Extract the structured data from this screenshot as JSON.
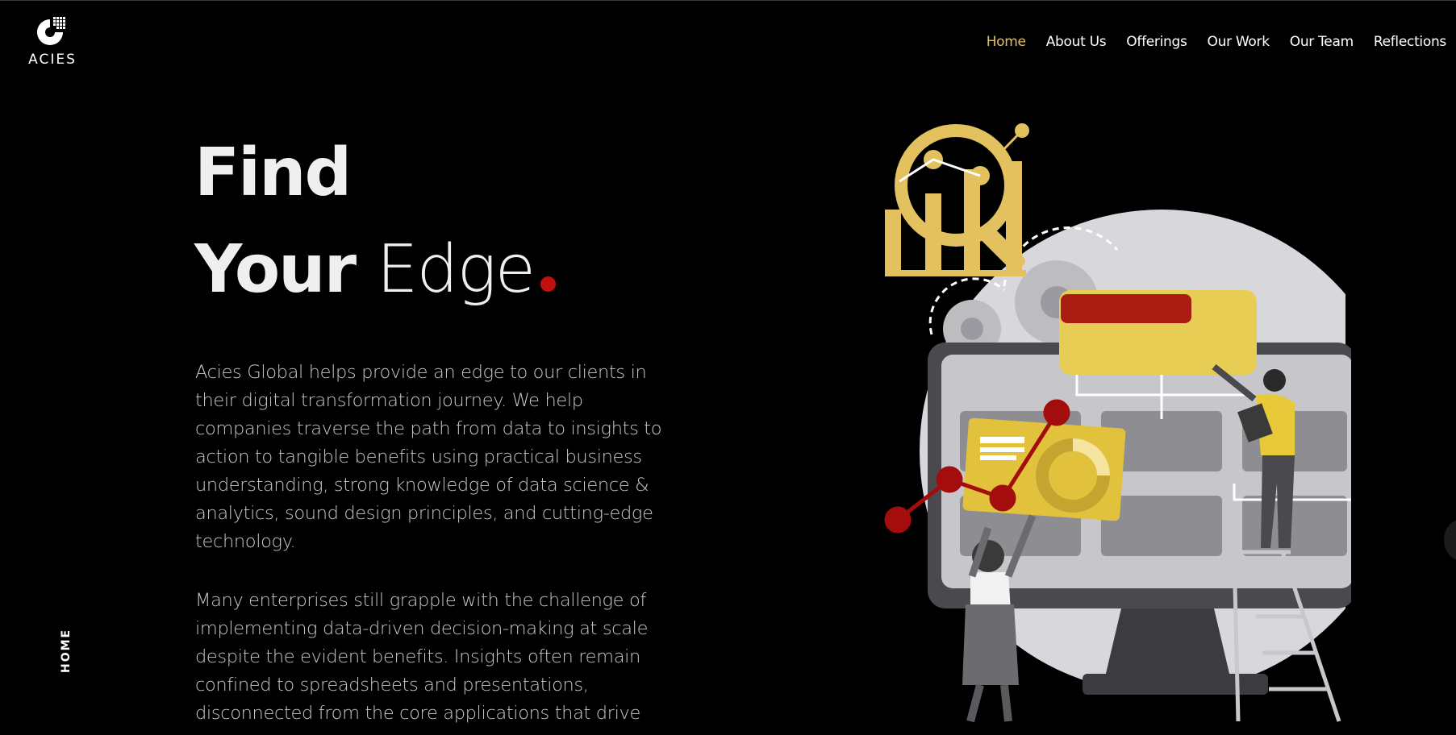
{
  "brand": {
    "name": "ACIES"
  },
  "nav": {
    "items": [
      {
        "label": "Home",
        "active": true
      },
      {
        "label": "About Us",
        "active": false
      },
      {
        "label": "Offerings",
        "active": false
      },
      {
        "label": "Our Work",
        "active": false
      },
      {
        "label": "Our Team",
        "active": false
      },
      {
        "label": "Reflections",
        "active": false
      }
    ]
  },
  "hero": {
    "line1": "Find",
    "line2_bold": "Your",
    "line2_light": "Edge"
  },
  "body": {
    "paragraph1": "Acies Global helps provide an edge to our clients in their digital transformation journey. We help companies traverse the path from data to insights to action to tangible benefits using practical business understanding, strong knowledge of data science & analytics, sound design principles, and cutting-edge technology.",
    "paragraph2": "Many enterprises still grapple with the challenge of implementing data-driven decision-making at scale despite the evident benefits. Insights often remain confined to spreadsheets and presentations, disconnected from the core applications that drive"
  },
  "section_label": "HOME",
  "colors": {
    "accent_gold": "#e2c15e",
    "accent_red": "#c01010",
    "background": "#000000"
  }
}
